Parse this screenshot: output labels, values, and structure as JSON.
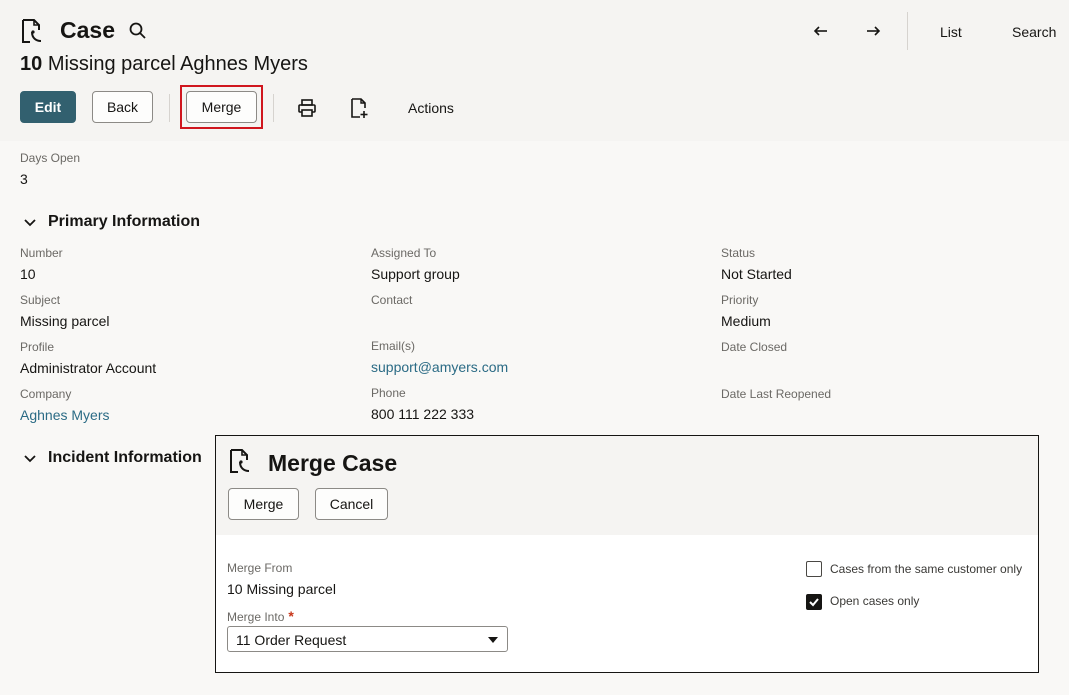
{
  "header": {
    "object_title": "Case",
    "record_number": "10",
    "record_name": "Missing parcel Aghnes Myers",
    "links": {
      "list": "List",
      "search": "Search"
    }
  },
  "toolbar": {
    "edit_label": "Edit",
    "back_label": "Back",
    "merge_label": "Merge",
    "actions_label": "Actions"
  },
  "summary": {
    "days_open_label": "Days Open",
    "days_open_value": "3"
  },
  "primary": {
    "title": "Primary Information",
    "fields": {
      "number_label": "Number",
      "number_value": "10",
      "subject_label": "Subject",
      "subject_value": "Missing parcel",
      "profile_label": "Profile",
      "profile_value": "Administrator Account",
      "company_label": "Company",
      "company_value": "Aghnes Myers",
      "assigned_label": "Assigned To",
      "assigned_value": "Support group",
      "contact_label": "Contact",
      "emails_label": "Email(s)",
      "emails_value": "support@amyers.com",
      "phone_label": "Phone",
      "phone_value": "800 111 222 333",
      "status_label": "Status",
      "status_value": "Not Started",
      "priority_label": "Priority",
      "priority_value": "Medium",
      "date_closed_label": "Date Closed",
      "date_reopened_label": "Date Last Reopened"
    }
  },
  "incident": {
    "title": "Incident Information"
  },
  "dialog": {
    "title": "Merge Case",
    "merge_label": "Merge",
    "cancel_label": "Cancel",
    "merge_from_label": "Merge From",
    "merge_from_value": "10 Missing parcel",
    "merge_into_label": "Merge Into",
    "required_mark": "*",
    "merge_into_value": "11 Order Request",
    "same_customer_label": "Cases from the same customer only",
    "same_customer_checked": false,
    "open_only_label": "Open cases only",
    "open_only_checked": true
  },
  "colors": {
    "primary_button": "#32606f",
    "link": "#2b6b85",
    "highlight": "#d0161e",
    "required": "#c7361a"
  },
  "icons": [
    "case-icon",
    "search-icon",
    "arrow-left-icon",
    "arrow-right-icon",
    "print-icon",
    "new-document-icon",
    "chevron-down-icon",
    "check-icon",
    "caret-down-icon"
  ]
}
